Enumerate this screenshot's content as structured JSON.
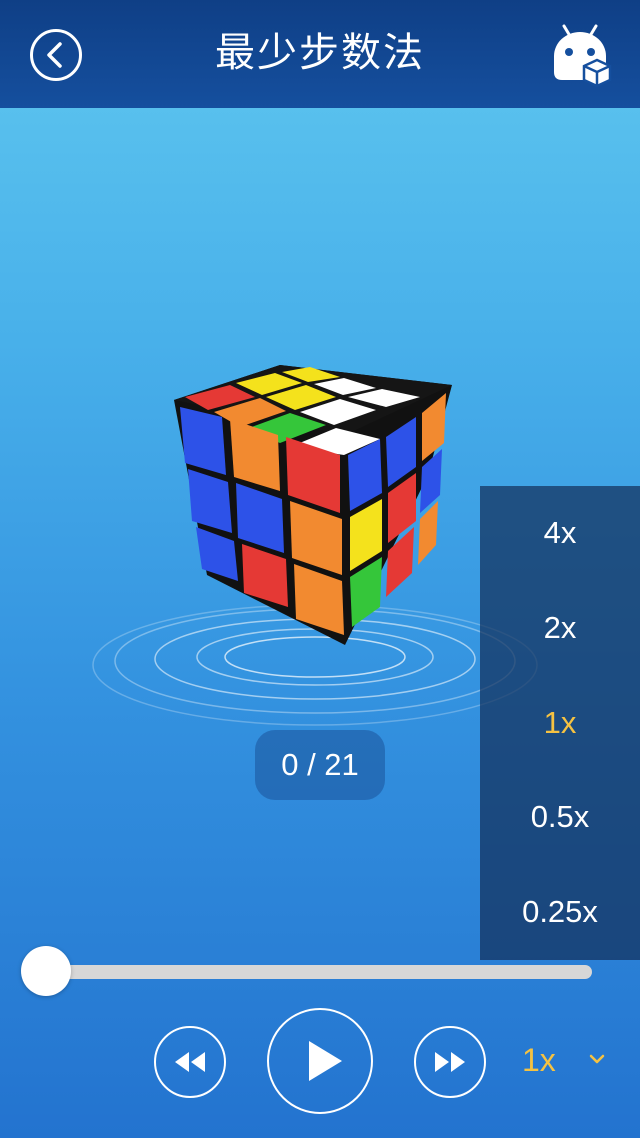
{
  "header": {
    "title": "最少步数法",
    "back_icon": "chevron-left-icon",
    "robot_icon": "robot-cube-icon"
  },
  "counter": {
    "text": "0 / 21"
  },
  "progress": {
    "value": 0
  },
  "speed_menu": {
    "options": [
      {
        "label": "4x",
        "selected": false
      },
      {
        "label": "2x",
        "selected": false
      },
      {
        "label": "1x",
        "selected": true
      },
      {
        "label": "0.5x",
        "selected": false
      },
      {
        "label": "0.25x",
        "selected": false
      }
    ]
  },
  "controls": {
    "rewind_icon": "rewind-icon",
    "play_icon": "play-icon",
    "forward_icon": "fast-forward-icon",
    "speed_label": "1x",
    "dropdown_icon": "chevron-down-icon"
  },
  "colors": {
    "header_bg": "#154f9e",
    "accent_yellow": "#f5c242",
    "background_top": "#5fc7ef",
    "background_bottom": "#2373cf"
  }
}
